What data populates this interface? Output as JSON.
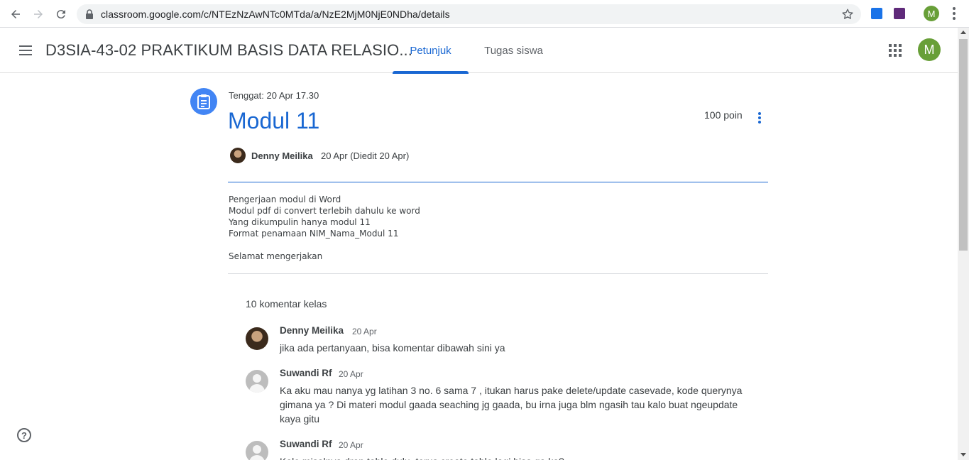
{
  "browser": {
    "url": "classroom.google.com/c/NTEzNzAwNTc0MTda/a/NzE2MjM0NjE0NDha/details",
    "profile_initial": "M"
  },
  "header": {
    "class_title": "D3SIA-43-02 PRAKTIKUM BASIS DATA RELASIO...",
    "tabs": [
      {
        "label": "Petunjuk",
        "active": true
      },
      {
        "label": "Tugas siswa",
        "active": false
      }
    ],
    "avatar_initial": "M"
  },
  "assignment": {
    "due": "Tenggat: 20 Apr 17.30",
    "title": "Modul 11",
    "points": "100 poin",
    "author": "Denny Meilika",
    "posted": "20 Apr (Diedit 20 Apr)",
    "description": [
      "Pengerjaan modul di Word",
      "Modul pdf di convert terlebih dahulu ke word",
      "Yang dikumpulin hanya modul 11",
      "Format penamaan NIM_Nama_Modul 11",
      "",
      "Selamat mengerjakan"
    ]
  },
  "comments": {
    "count_label": "10 komentar kelas",
    "items": [
      {
        "author": "Denny Meilika",
        "date": "20 Apr",
        "text": "jika ada pertanyaan, bisa komentar dibawah sini ya"
      },
      {
        "author": "Suwandi Rf",
        "date": "20 Apr",
        "text": "Ka aku mau nanya yg latihan 3 no. 6 sama 7 , itukan harus pake delete/update casevade, kode querynya gimana ya ? Di materi modul gaada seaching jg gaada, bu irna juga blm ngasih tau kalo buat ngeupdate kaya gitu"
      },
      {
        "author": "Suwandi Rf",
        "date": "20 Apr",
        "text": "Kalo misalnya drop table dulu, terus create table lagi bisa ga ka?"
      }
    ]
  },
  "colors": {
    "accent": "#1967d2",
    "assignment_icon_bg": "#4285f4",
    "avatar_bg": "#689f38"
  },
  "icons": [
    "back-arrow-icon",
    "forward-arrow-icon",
    "reload-icon",
    "lock-icon",
    "star-icon",
    "menu-icon",
    "apps-icon",
    "assignment-icon",
    "more-vert-icon",
    "help-icon"
  ]
}
